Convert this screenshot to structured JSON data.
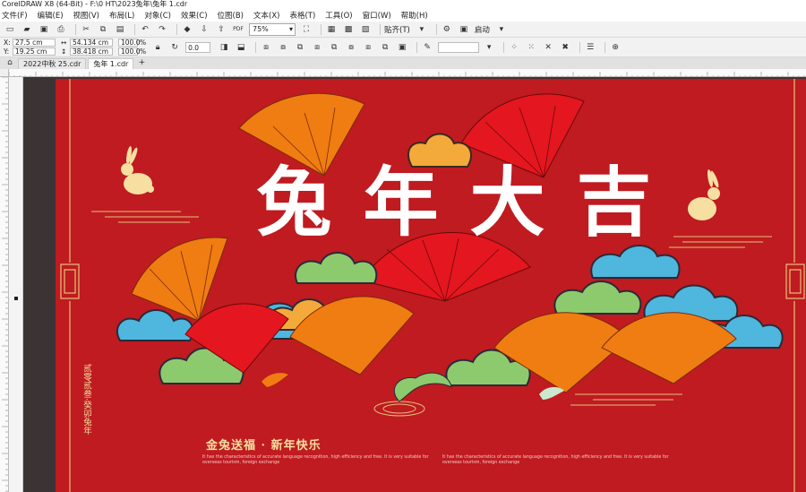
{
  "window": {
    "title": "CorelDRAW X8 (64-Bit) - F:\\0 HT\\2023兔年\\兔年 1.cdr"
  },
  "menu": [
    {
      "label": "文件(F)"
    },
    {
      "label": "编辑(E)"
    },
    {
      "label": "视图(V)"
    },
    {
      "label": "布局(L)"
    },
    {
      "label": "对象(C)"
    },
    {
      "label": "效果(C)"
    },
    {
      "label": "位图(B)"
    },
    {
      "label": "文本(X)"
    },
    {
      "label": "表格(T)"
    },
    {
      "label": "工具(O)"
    },
    {
      "label": "窗口(W)"
    },
    {
      "label": "帮助(H)"
    }
  ],
  "toolbar": {
    "zoom": "75%",
    "snap_label": "贴齐(T)",
    "launch_label": "启动",
    "pdf_label": "PDF"
  },
  "property_bar": {
    "x": "27.5 cm",
    "y": "19.25 cm",
    "width": "54.134 cm",
    "height": "38.418 cm",
    "scale_x": "100.0",
    "scale_y": "100.0",
    "pct": "%",
    "angle": "0.0",
    "x_label": "X:",
    "y_label": "Y:"
  },
  "tabs": [
    {
      "label": "2022中秋 25.cdr"
    },
    {
      "label": "兔年 1.cdr"
    }
  ],
  "design": {
    "title_chars": [
      "兔",
      "年",
      "大",
      "吉"
    ],
    "slogan": "金兔送福 · 新年快乐",
    "vertical_text": "贰零贰叁·癸卯兔年",
    "caption_1": "It has the characteristics of accurate language recognition, high efficiency and free. It is very suitable for",
    "caption_1b": "overseas tourism, foreign exchange",
    "caption_2": "It has the characteristics of accurate language recognition, high efficiency and free. It is very suitable for",
    "caption_2b": "overseas tourism, foreign exchange"
  },
  "colors": {
    "background": "#bf1b20",
    "fan_orange": "#f07d12",
    "fan_red": "#e4161f",
    "cloud_blue": "#4fb6dd",
    "cloud_green": "#8dca6e",
    "cloud_yellow": "#f4aa3a",
    "gold": "#f6dfa0"
  }
}
